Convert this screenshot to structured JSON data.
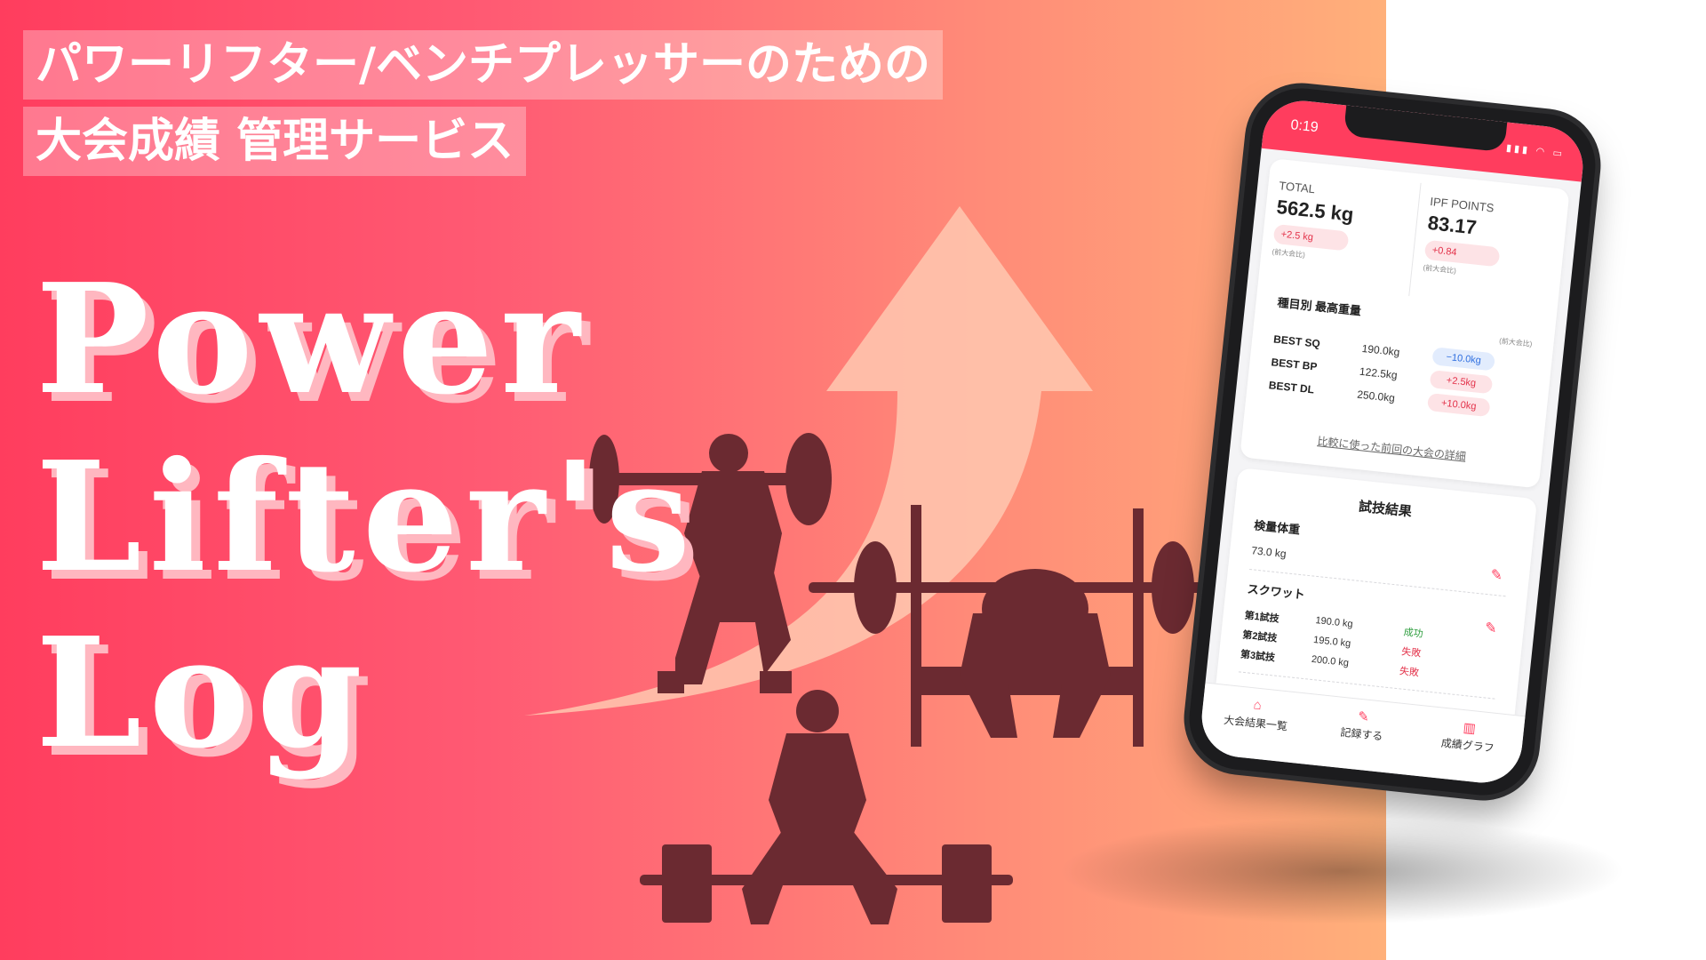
{
  "banner": {
    "tagline_1": "パワーリフター/ベンチプレッサーのための",
    "tagline_2": "大会成績 管理サービス",
    "logo_line_1": "Power",
    "logo_line_2": "Lifter's",
    "logo_line_3": "Log"
  },
  "colors": {
    "brand": "#ff3d5e",
    "silhouette": "#6b2a31",
    "arrow": "#ffc8b0",
    "gain": "#e3324a",
    "loss": "#2f6fe0",
    "success": "#2e9e3e"
  },
  "phone": {
    "status_time": "0:19",
    "status_icons": [
      "signal-icon",
      "wifi-icon",
      "battery-icon"
    ],
    "stats": {
      "total_label": "TOTAL",
      "total_value": "562.5 kg",
      "total_diff": "+2.5 kg",
      "total_note": "(前大会比)",
      "ipf_label": "IPF POINTS",
      "ipf_value": "83.17",
      "ipf_diff": "+0.84",
      "ipf_note": "(前大会比)"
    },
    "best": {
      "title": "種目別 最高重量",
      "note": "(前大会比)",
      "rows": [
        {
          "name": "BEST SQ",
          "value": "190.0kg",
          "diff": "−10.0kg",
          "direction": "down"
        },
        {
          "name": "BEST BP",
          "value": "122.5kg",
          "diff": "+2.5kg",
          "direction": "up"
        },
        {
          "name": "BEST DL",
          "value": "250.0kg",
          "diff": "+10.0kg",
          "direction": "up"
        }
      ],
      "link": "比較に使った前回の大会の詳細"
    },
    "results": {
      "title": "試技結果",
      "bodyweight_label": "検量体重",
      "bodyweight_value": "73.0 kg",
      "squat_label": "スクワット",
      "attempts": [
        {
          "name": "第1試技",
          "weight": "190.0 kg",
          "result": "成功"
        },
        {
          "name": "第2試技",
          "weight": "195.0 kg",
          "result": "失敗"
        },
        {
          "name": "第3試技",
          "weight": "200.0 kg",
          "result": "失敗"
        }
      ]
    },
    "tabs": [
      {
        "icon": "home-icon",
        "label": "大会結果一覧"
      },
      {
        "icon": "edit-icon",
        "label": "記録する"
      },
      {
        "icon": "chart-icon",
        "label": "成績グラフ"
      }
    ]
  }
}
